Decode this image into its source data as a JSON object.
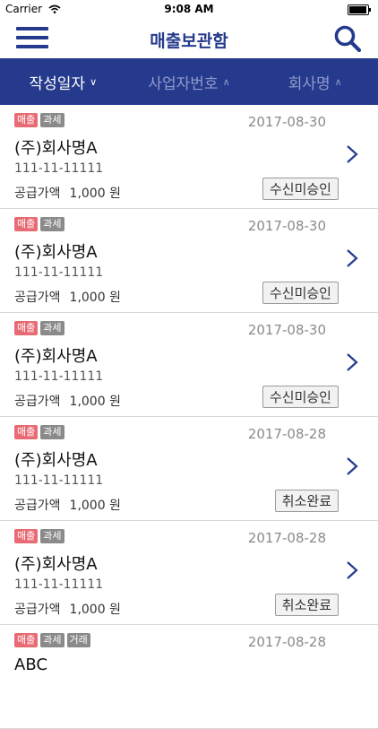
{
  "status_bar": {
    "carrier": "Carrier",
    "time": "9:08 AM",
    "battery_level": 1.0
  },
  "nav": {
    "title": "매출보관함",
    "menu_icon": "hamburger-menu-icon",
    "search_icon": "search-icon"
  },
  "sort_bar": {
    "items": [
      {
        "label": "작성일자",
        "direction": "down",
        "active": true
      },
      {
        "label": "사업자번호",
        "direction": "up",
        "active": false
      },
      {
        "label": "회사명",
        "direction": "up",
        "active": false
      }
    ]
  },
  "colors": {
    "primary": "#253a8c",
    "sales_badge": "#e86a73",
    "tax_badge": "#8a8a8a"
  },
  "items": [
    {
      "badges": [
        "매출",
        "과세"
      ],
      "date": "2017-08-30",
      "company": "(주)회사명A",
      "biz_no": "111-11-11111",
      "amount_label": "공급가액",
      "amount": "1,000 원",
      "status": "수신미승인"
    },
    {
      "badges": [
        "매출",
        "과세"
      ],
      "date": "2017-08-30",
      "company": "(주)회사명A",
      "biz_no": "111-11-11111",
      "amount_label": "공급가액",
      "amount": "1,000 원",
      "status": "수신미승인"
    },
    {
      "badges": [
        "매출",
        "과세"
      ],
      "date": "2017-08-30",
      "company": "(주)회사명A",
      "biz_no": "111-11-11111",
      "amount_label": "공급가액",
      "amount": "1,000 원",
      "status": "수신미승인"
    },
    {
      "badges": [
        "매출",
        "과세"
      ],
      "date": "2017-08-28",
      "company": "(주)회사명A",
      "biz_no": "111-11-11111",
      "amount_label": "공급가액",
      "amount": "1,000 원",
      "status": "취소완료"
    },
    {
      "badges": [
        "매출",
        "과세"
      ],
      "date": "2017-08-28",
      "company": "(주)회사명A",
      "biz_no": "111-11-11111",
      "amount_label": "공급가액",
      "amount": "1,000 원",
      "status": "취소완료"
    },
    {
      "badges": [
        "매출",
        "과세",
        "거래"
      ],
      "date": "2017-08-28",
      "company": "ABC",
      "biz_no": "",
      "amount_label": "",
      "amount": "",
      "status": ""
    }
  ]
}
